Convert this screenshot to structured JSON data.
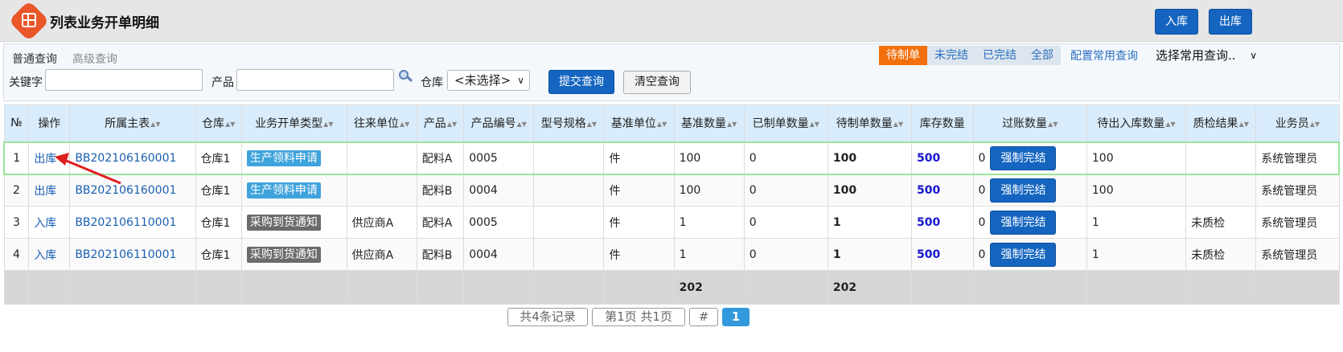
{
  "header": {
    "title": "列表业务开单明细",
    "btn_in": "入库",
    "btn_out": "出库"
  },
  "query": {
    "tab_normal": "普通查询",
    "tab_advanced": "高级查询",
    "status_tabs": [
      "待制单",
      "未完结",
      "已完结",
      "全部"
    ],
    "config_link": "配置常用查询",
    "common_select": "选择常用查询..",
    "keyword_label": "关键字",
    "keyword_value": "",
    "product_label": "产品",
    "product_value": "",
    "warehouse_label": "仓库",
    "warehouse_value": "<未选择>",
    "submit": "提交查询",
    "clear": "清空查询"
  },
  "table": {
    "headers": [
      "№",
      "操作",
      "所属主表",
      "仓库",
      "业务开单类型",
      "往来单位",
      "产品",
      "产品编号",
      "型号规格",
      "基准单位",
      "基准数量",
      "已制单数量",
      "待制单数量",
      "库存数量",
      "过账数量",
      "待出入库数量",
      "质检结果",
      "业务员"
    ],
    "rows": [
      {
        "no": "1",
        "op": "出库",
        "master": "BB202106160001",
        "wh": "仓库1",
        "type": "生产领料申请",
        "partner": "",
        "product": "配料A",
        "code": "0005",
        "spec": "",
        "unit": "件",
        "base_qty": "100",
        "made_qty": "0",
        "pending_qty": "100",
        "stock": "500",
        "posted": "0",
        "force": "强制完结",
        "io_qty": "100",
        "qc": "",
        "clerk": "系统管理员"
      },
      {
        "no": "2",
        "op": "出库",
        "master": "BB202106160001",
        "wh": "仓库1",
        "type": "生产领料申请",
        "partner": "",
        "product": "配料B",
        "code": "0004",
        "spec": "",
        "unit": "件",
        "base_qty": "100",
        "made_qty": "0",
        "pending_qty": "100",
        "stock": "500",
        "posted": "0",
        "force": "强制完结",
        "io_qty": "100",
        "qc": "",
        "clerk": "系统管理员"
      },
      {
        "no": "3",
        "op": "入库",
        "master": "BB202106110001",
        "wh": "仓库1",
        "type": "采购到货通知",
        "partner": "供应商A",
        "product": "配料A",
        "code": "0005",
        "spec": "",
        "unit": "件",
        "base_qty": "1",
        "made_qty": "0",
        "pending_qty": "1",
        "stock": "500",
        "posted": "0",
        "force": "强制完结",
        "io_qty": "1",
        "qc": "未质检",
        "clerk": "系统管理员"
      },
      {
        "no": "4",
        "op": "入库",
        "master": "BB202106110001",
        "wh": "仓库1",
        "type": "采购到货通知",
        "partner": "供应商A",
        "product": "配料B",
        "code": "0004",
        "spec": "",
        "unit": "件",
        "base_qty": "1",
        "made_qty": "0",
        "pending_qty": "1",
        "stock": "500",
        "posted": "0",
        "force": "强制完结",
        "io_qty": "1",
        "qc": "未质检",
        "clerk": "系统管理员"
      }
    ],
    "totals": {
      "base_qty": "202",
      "pending_qty": "202"
    }
  },
  "pager": {
    "records": "共4条记录",
    "pages": "第1页 共1页",
    "hash": "#",
    "current": "1"
  },
  "colors": {
    "accent": "#1565c0",
    "status_active": "#f26f0c",
    "header_bg": "#d9ecfb",
    "stock_text": "#1515d0",
    "tag_blue": "#3fa3dc",
    "tag_gray": "#6b6b6b",
    "annotation_arrow": "#e02020"
  }
}
